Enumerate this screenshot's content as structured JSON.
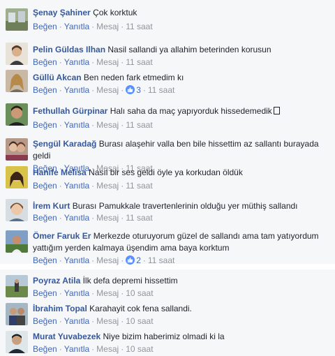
{
  "actions": {
    "like": "Beğen",
    "reply": "Yanıtla",
    "message": "Mesaj"
  },
  "comments": [
    {
      "author": "Şenay Şahiner",
      "text": "Çok korktuk",
      "time": "11 saat",
      "reactions": ""
    },
    {
      "author": "Pelin Güldas Ilhan",
      "text": "Nasil sallandi ya allahim beterinden korusun",
      "time": "11 saat",
      "reactions": ""
    },
    {
      "author": "Güllü Akcan",
      "text": "Ben neden fark etmedim kı",
      "time": "11 saat",
      "reactions": "3"
    },
    {
      "author": "Fethullah Gürpinar",
      "text": "Halı saha da maç yapıyorduk hissedemedik",
      "time": "11 saat",
      "reactions": ""
    },
    {
      "author": "Şengül Karadağ",
      "text": "Burası alaşehir valla ben bile hissettim az sallantı burayada geldi",
      "time": "11 saat",
      "reactions": ""
    },
    {
      "author": "Hanife Melisa",
      "text": "Nasıl bir ses geldi öyle ya korkudan öldük",
      "time": "11 saat",
      "reactions": ""
    },
    {
      "author": "İrem Kurt",
      "text": "Burası Pamukkale travertenlerinin olduğu yer müthiş sallandı",
      "time": "11 saat",
      "reactions": ""
    },
    {
      "author": "Ömer Faruk Er",
      "text": "Merkezde oturuyorum güzel de sallandı ama tam yatıyordum yattığım yerden kalmaya üşendim ama baya korktum",
      "time": "11 saat",
      "reactions": "2"
    },
    {
      "author": "Poyraz Atila",
      "text": "İlk defa depremi hissettim",
      "time": "10 saat",
      "reactions": ""
    },
    {
      "author": "İbrahim Topal",
      "text": "Karahayit cok fena sallandi.",
      "time": "10 saat",
      "reactions": ""
    },
    {
      "author": "Murat Yuvabezek",
      "text": "Niye bizim haberimiz olmadi ki la",
      "time": "10 saat",
      "reactions": ""
    }
  ],
  "colors": {
    "author": "#365899",
    "link": "#4267b2",
    "meta": "#90949c",
    "background": "#f6f7f9",
    "like_badge": "#5890ff"
  }
}
